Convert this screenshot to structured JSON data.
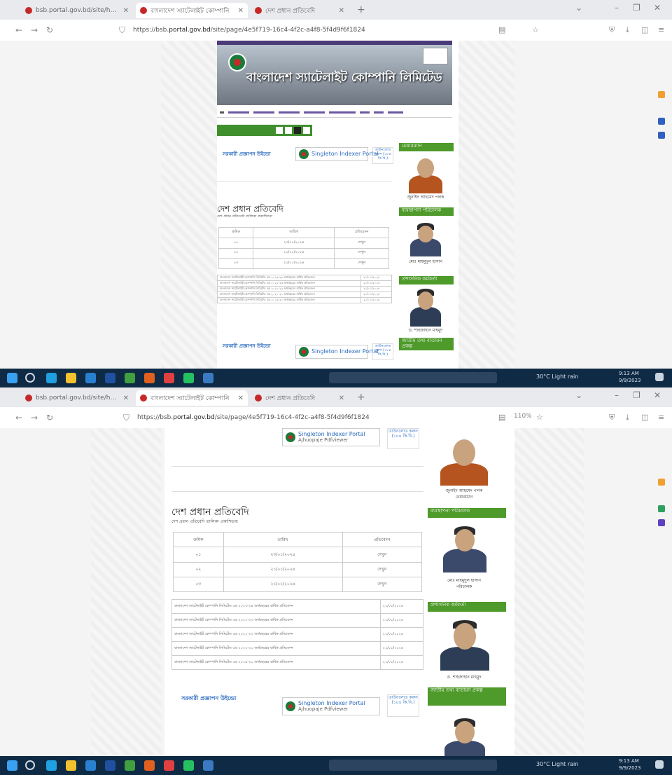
{
  "browser": {
    "tabs": [
      {
        "title": "bsb.portal.gov.bd/site/home",
        "active": false
      },
      {
        "title": "বাংলাদেশ স্যাটেলাইট কোম্পানি",
        "active": true
      },
      {
        "title": "দেশ প্রধান প্রতিবেদি",
        "active": false
      }
    ],
    "new_tab": "+",
    "url_prefix": "https://bsb.",
    "url_host": "portal.gov.bd",
    "url_rest": "/site/page/4e5f719-16c4-4f2c-a4f8-5f4d9f6f1824",
    "zoom_top": "",
    "zoom_bottom": "110%"
  },
  "site": {
    "banner_title": "বাংলাদেশ স্যাটেলাইট কোম্পানি লিমিটেড",
    "notice_title": "সরকারী প্রজ্ঞাপন উইন্ডো",
    "pdf_chip_title": "Singleton Indexer Portal",
    "pdf_chip_sub": "Ajhuopaje  Pdfviewer",
    "download_label": "ডাউনলোড করুন (১৮৪ কি.বি.)",
    "section_heading": "দেশ প্রধান প্রতিবেদি",
    "section_subheading": "দেশ প্রধান প্রতিবেদি তালিকা প্রকাশিতব্য",
    "table": {
      "headers": [
        "ক্রমিক",
        "তারিখ",
        "প্রতিবেদন"
      ],
      "rows": [
        [
          "০১",
          "২৩/০১/২০২৪",
          "দেখুন"
        ],
        [
          "০২",
          "২১/০১/২০২৪",
          "দেখুন"
        ],
        [
          "০৩",
          "২১/০১/২০২৪",
          "দেখুন"
        ]
      ]
    },
    "reports": [
      {
        "text": "বাংলাদেশ স্যাটেলাইট কোম্পানি লিমিটেড এর ২০২৩-২৪ অর্থবছরের বার্ষিক প্রতিবেদন",
        "date": "২১/০১/২০২৪"
      },
      {
        "text": "বাংলাদেশ স্যাটেলাইট কোম্পানি লিমিটেড এর ২০২২-২৩ অর্থবছরের বার্ষিক প্রতিবেদন",
        "date": "২১/০১/২০২৪"
      },
      {
        "text": "বাংলাদেশ স্যাটেলাইট কোম্পানি লিমিটেড এর ২০২১-২২ অর্থবছরের বার্ষিক প্রতিবেদন",
        "date": "২১/০১/২০২৪"
      },
      {
        "text": "বাংলাদেশ স্যাটেলাইট কোম্পানি লিমিটেড এর ২০২০-২১ অর্থবছরের বার্ষিক প্রতিবেদন",
        "date": "২১/০১/২০২৪"
      },
      {
        "text": "বাংলাদেশ স্যাটেলাইট কোম্পানি লিমিটেড এর ২০১৯-২০ অর্থবছরের বার্ষিক প্রতিবেদন",
        "date": "২১/০১/২০২৪"
      }
    ],
    "sidebar": [
      {
        "label": "চেয়ারম্যান",
        "name": "জুনাইদ আহমেদ পলক",
        "title": "চেয়ারম্যান",
        "color": "#b5541f"
      },
      {
        "label": "ব্যবস্থাপনা পরিচালক",
        "name": "মোঃ মাহমুদুল হাসান",
        "title": "পরিচালক",
        "color": "#3b4a6b"
      },
      {
        "label": "প্রশাসনিক কর্মকর্তা",
        "name": "ড. শাহজাহান মাহমুদ",
        "title": "",
        "color": "#2e3d56"
      },
      {
        "label": "জাতীয় তথ্য বাতায়ন প্রকল্প",
        "name": "",
        "title": "",
        "color": "#3b4a6b"
      }
    ]
  },
  "taskbar": {
    "weather": "30°C Light rain",
    "time": "9:13 AM",
    "date": "9/9/2023"
  }
}
